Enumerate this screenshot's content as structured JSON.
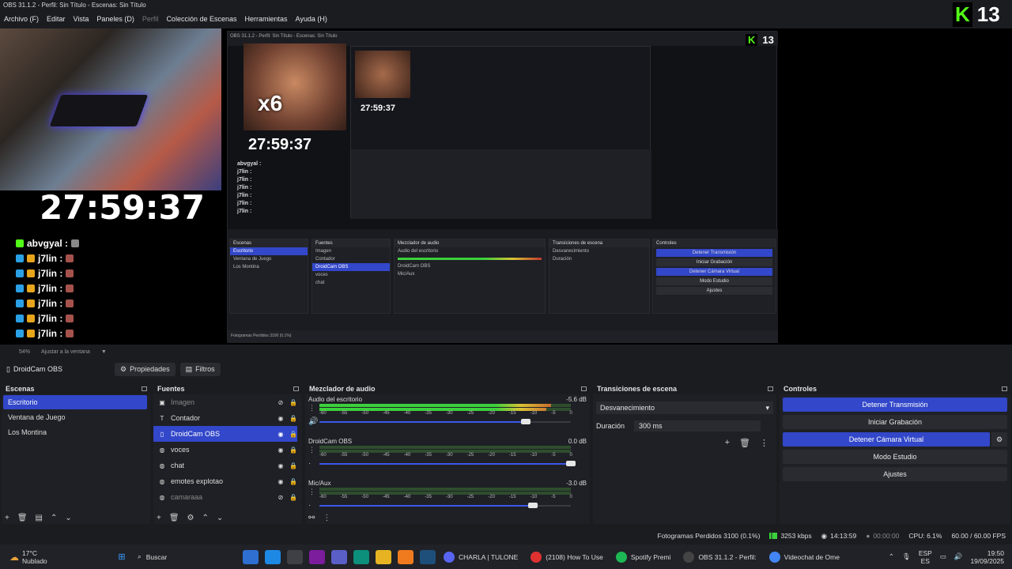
{
  "window": {
    "title": "OBS 31.1.2 - Perfil: Sin Título - Escenas: Sin Título"
  },
  "menu": [
    "Archivo (F)",
    "Editar",
    "Vista",
    "Paneles (D)",
    "Perfil",
    "Colección de Escenas",
    "Herramientas",
    "Ayuda (H)"
  ],
  "overlay": {
    "kick_count": "13",
    "timer": "27:59:37",
    "multiplier": "x6"
  },
  "chat": {
    "first_user": "abvgyal :",
    "user": "j7lin :",
    "lines": 6
  },
  "zoom": {
    "percent": "54%",
    "fit_label": "Ajustar a la ventana"
  },
  "source_toolbar": {
    "source": "DroidCam OBS",
    "properties": "Propiedades",
    "filters": "Filtros"
  },
  "scenes": {
    "title": "Escenas",
    "items": [
      "Escritorio",
      "Ventana de Juego",
      "Los Montina"
    ],
    "selected": 0
  },
  "sources": {
    "title": "Fuentes",
    "items": [
      {
        "name": "Imagen",
        "icon": "image-icon",
        "visible": false
      },
      {
        "name": "Contador",
        "icon": "text-icon",
        "visible": true
      },
      {
        "name": "DroidCam OBS",
        "icon": "capture-icon",
        "visible": true
      },
      {
        "name": "voces",
        "icon": "globe-icon",
        "visible": true
      },
      {
        "name": "chat",
        "icon": "globe-icon",
        "visible": true
      },
      {
        "name": "emotes explotao",
        "icon": "globe-icon",
        "visible": true
      },
      {
        "name": "camaraaa",
        "icon": "globe-icon",
        "visible": false
      }
    ],
    "selected": 2
  },
  "mixer": {
    "title": "Mezclador de audio",
    "ticks": [
      "-60",
      "-55",
      "-50",
      "-45",
      "-40",
      "-35",
      "-30",
      "-25",
      "-20",
      "-15",
      "-10",
      "-5",
      "0"
    ],
    "channels": [
      {
        "name": "Audio del escritorio",
        "db": "-5.6 dB",
        "level": 0.92,
        "volume": 0.82
      },
      {
        "name": "DroidCam OBS",
        "db": "0.0 dB",
        "level": 0.0,
        "volume": 1.0
      },
      {
        "name": "Mic/Aux",
        "db": "-3.0 dB",
        "level": 0.0,
        "volume": 0.85
      }
    ]
  },
  "transitions": {
    "title": "Transiciones de escena",
    "selected": "Desvanecimiento",
    "duration_label": "Duración",
    "duration_value": "300 ms"
  },
  "controls": {
    "title": "Controles",
    "buttons": [
      {
        "label": "Detener Transmisión",
        "active": true
      },
      {
        "label": "Iniciar Grabación",
        "active": false
      },
      {
        "label": "Detener Cámara Virtual",
        "active": true
      },
      {
        "label": "Modo Estudio",
        "active": false
      },
      {
        "label": "Ajustes",
        "active": false
      }
    ]
  },
  "status": {
    "dropped": "Fotogramas Perdidos 3100 (0.1%)",
    "bitrate": "3253 kbps",
    "stream_time": "14:13:59",
    "rec_time": "00:00:00",
    "cpu": "CPU: 6.1%",
    "fps": "60.00 / 60.00 FPS"
  },
  "taskbar": {
    "weather_temp": "17°C",
    "weather_desc": "Nublado",
    "search": "Buscar",
    "apps": [
      {
        "label": "CHARLA | TULONE",
        "color": "#5865f2"
      },
      {
        "label": "(2108) How To Use",
        "color": "#e03131"
      },
      {
        "label": "Spotify Premi",
        "color": "#1db954"
      },
      {
        "label": "OBS 31.1.2 - Perfil:",
        "color": "#444"
      },
      {
        "label": "Videochat de Ome",
        "color": "#4285f4"
      }
    ],
    "lang": "ESP",
    "region": "ES",
    "time": "19:50",
    "date": "19/09/2025"
  },
  "colors": {
    "accent": "#3247c9",
    "kick_green": "#53fc18"
  }
}
